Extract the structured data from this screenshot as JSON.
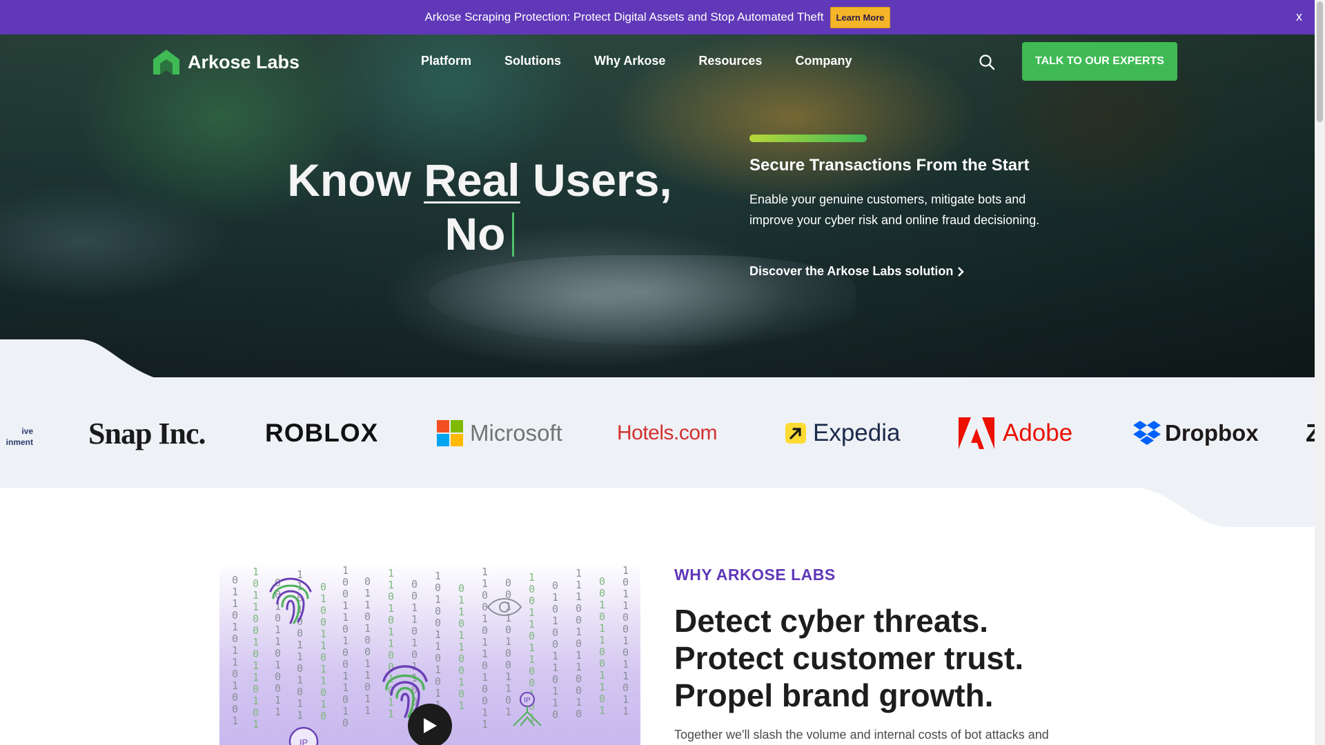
{
  "announcement": {
    "text": "Arkose Scraping Protection: Protect Digital Assets and Stop Automated Theft",
    "button": "Learn More",
    "close": "x"
  },
  "header": {
    "logo_text": "Arkose Labs",
    "nav": [
      "Platform",
      "Solutions",
      "Why Arkose",
      "Resources",
      "Company"
    ],
    "search_icon": "search-icon",
    "cta": "TALK TO OUR EXPERTS"
  },
  "hero": {
    "headline_part1": "Know ",
    "headline_underlined": "Real",
    "headline_part2": " Users,",
    "headline_line2": "No",
    "side_title": "Secure Transactions From the Start",
    "side_body": "Enable your genuine customers, mitigate bots and improve your cyber risk and online fraud decisioning.",
    "side_link": "Discover the Arkose Labs solution"
  },
  "customers": {
    "partial_left": [
      "ive",
      "inment"
    ],
    "logos": [
      "Snap Inc.",
      "ROBLOX",
      "Microsoft",
      "Hotels.com",
      "Expedia",
      "Adobe",
      "Dropbox"
    ],
    "partial_right": "Z"
  },
  "why": {
    "eyebrow": "WHY ARKOSE LABS",
    "title_lines": [
      "Detect cyber threats.",
      "Protect customer trust.",
      "Propel brand growth."
    ],
    "body": "Together we'll slash the volume and internal costs of bot attacks and"
  },
  "colors": {
    "brand_purple": "#6038b8",
    "brand_green": "#3fba55",
    "announce_button": "#f4b528",
    "strip_bg": "#eef1f6"
  }
}
